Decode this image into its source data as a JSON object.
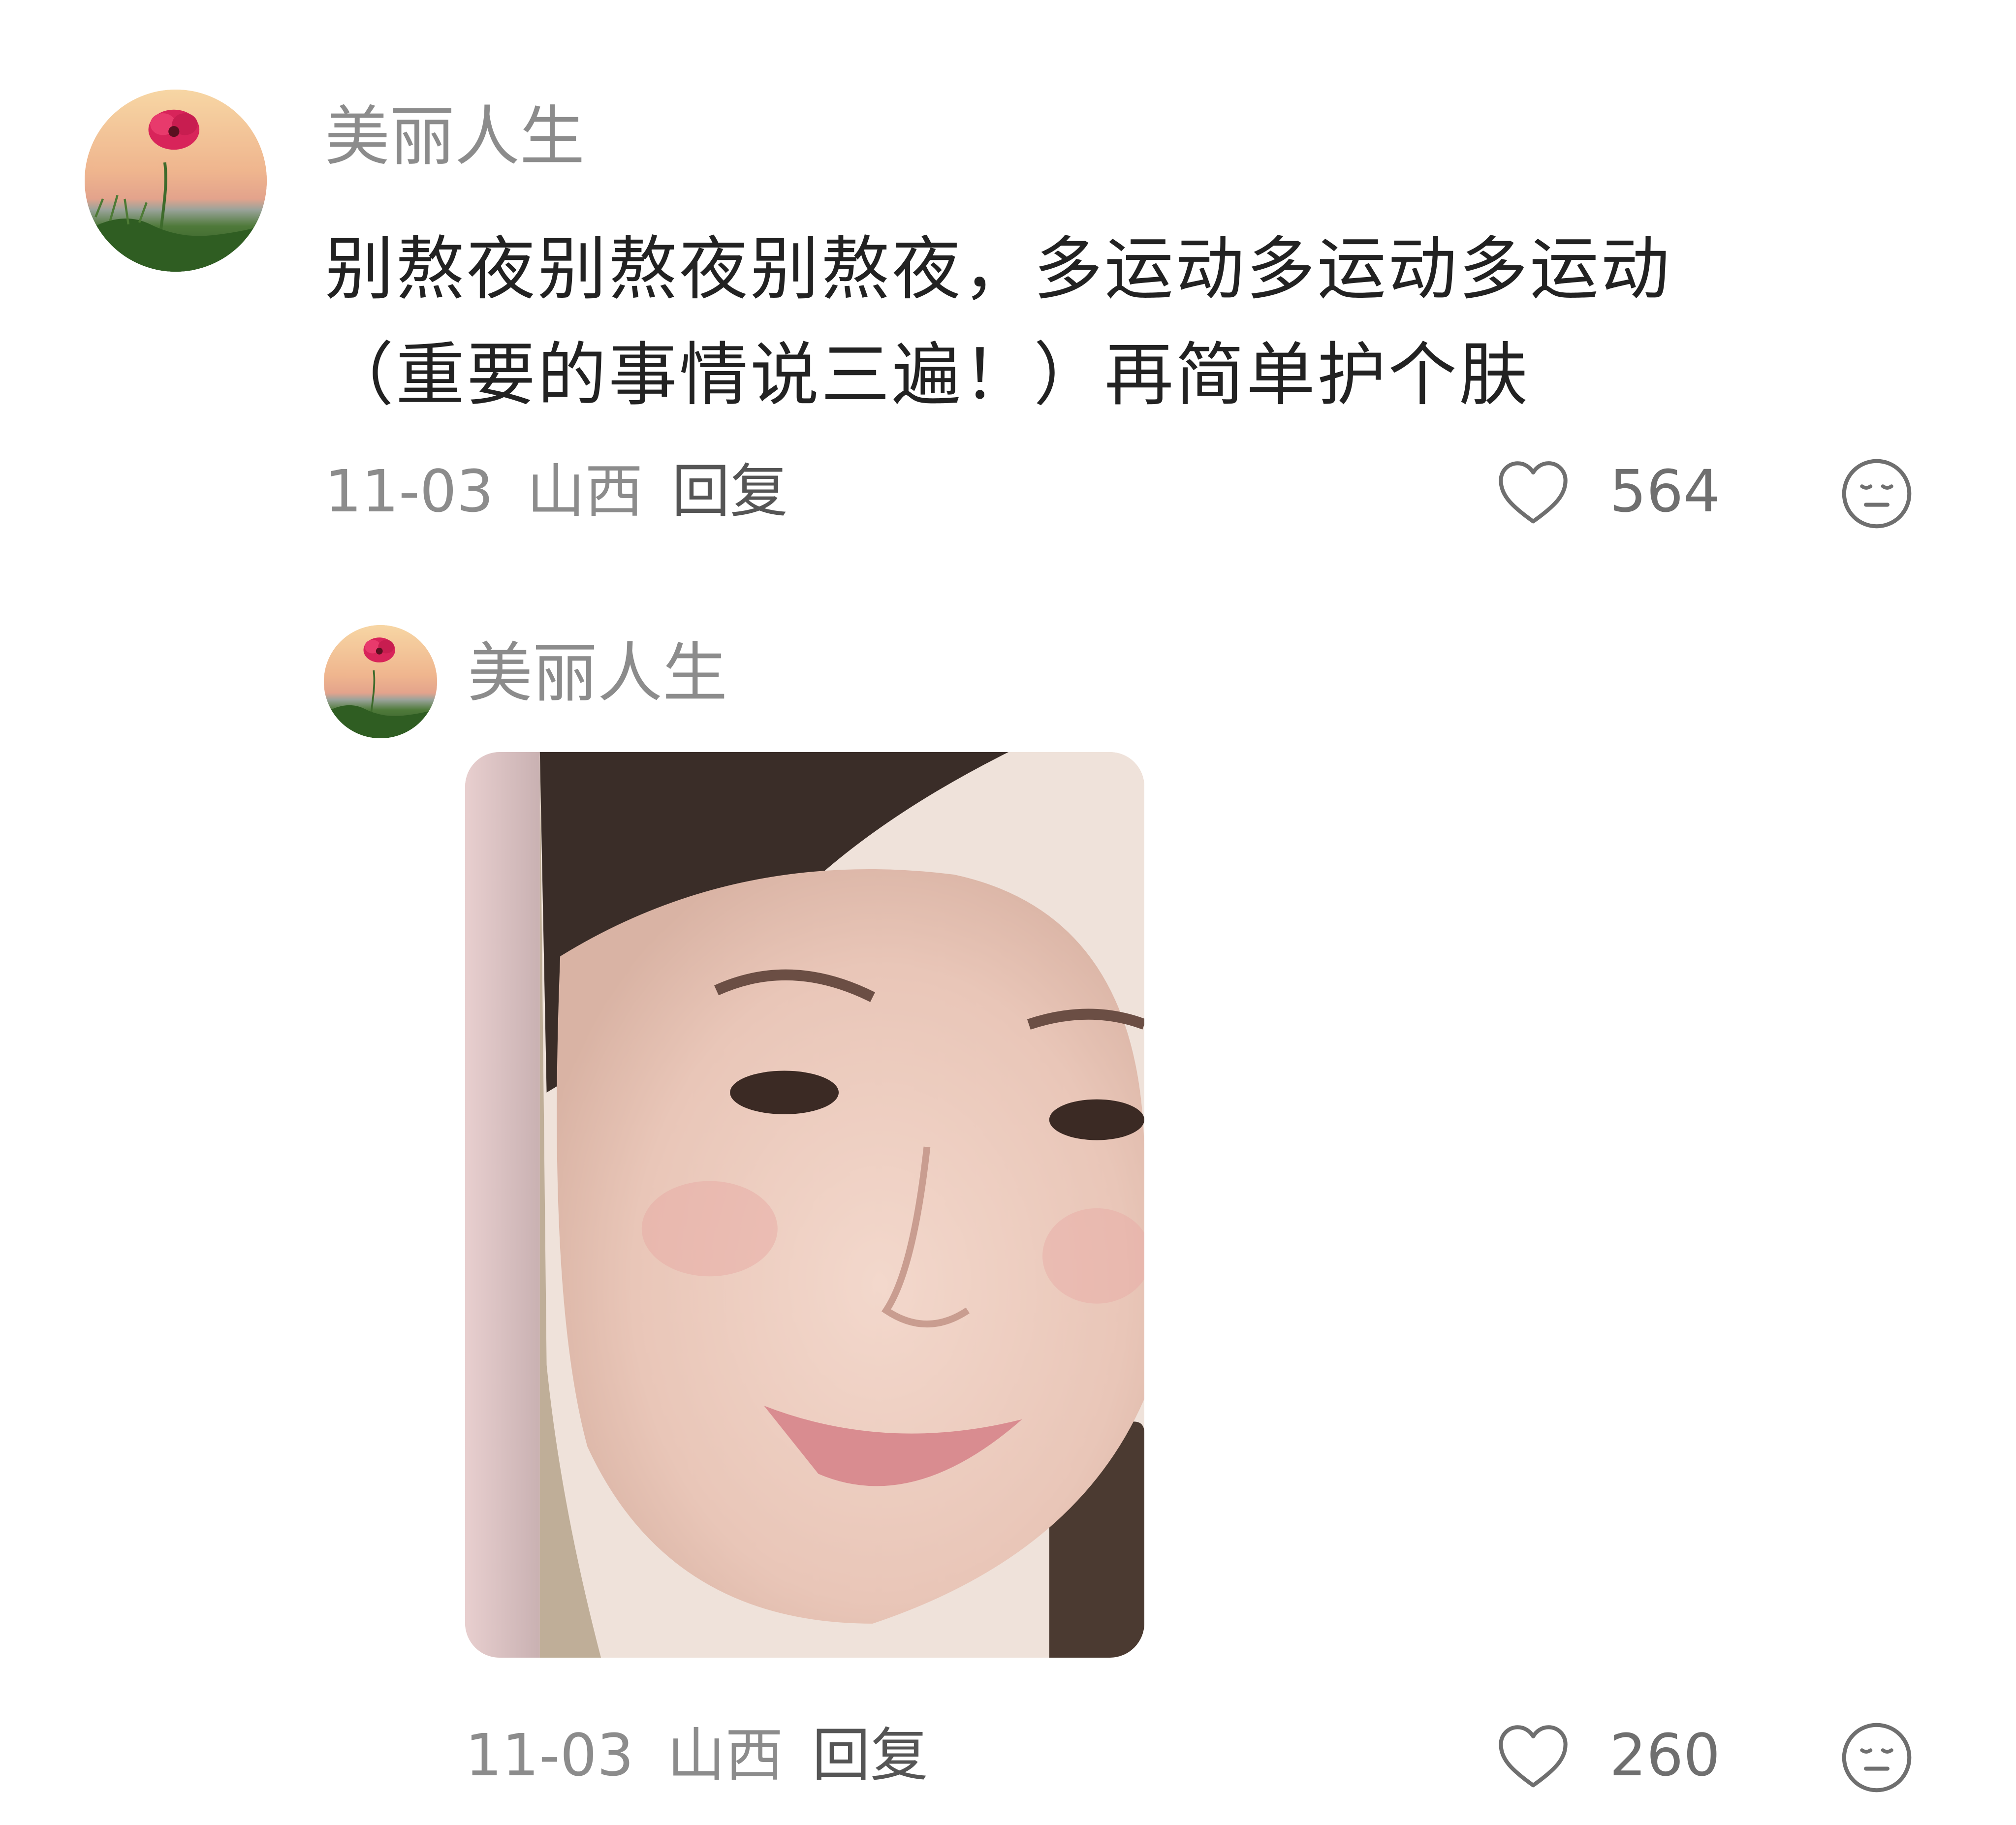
{
  "comments": [
    {
      "username": "美丽人生",
      "text_line1": "别熬夜别熬夜别熬夜，多运动多运动多运动",
      "text_line2": "（重要的事情说三遍！）再简单护个肤",
      "date": "11-03",
      "location": "山西",
      "reply_label": "回复",
      "likes": "564"
    }
  ],
  "replies": [
    {
      "username": "美丽人生",
      "attachment": "photo",
      "date": "11-03",
      "location": "山西",
      "reply_label": "回复",
      "likes": "260"
    }
  ],
  "icons": {
    "like": "heart-outline-icon",
    "emoji": "neutral-face-icon"
  },
  "colors": {
    "username": "#8c8c8c",
    "body_text": "#222222",
    "meta_text": "#8c8c8c",
    "icon_stroke": "#6f6f6f"
  }
}
